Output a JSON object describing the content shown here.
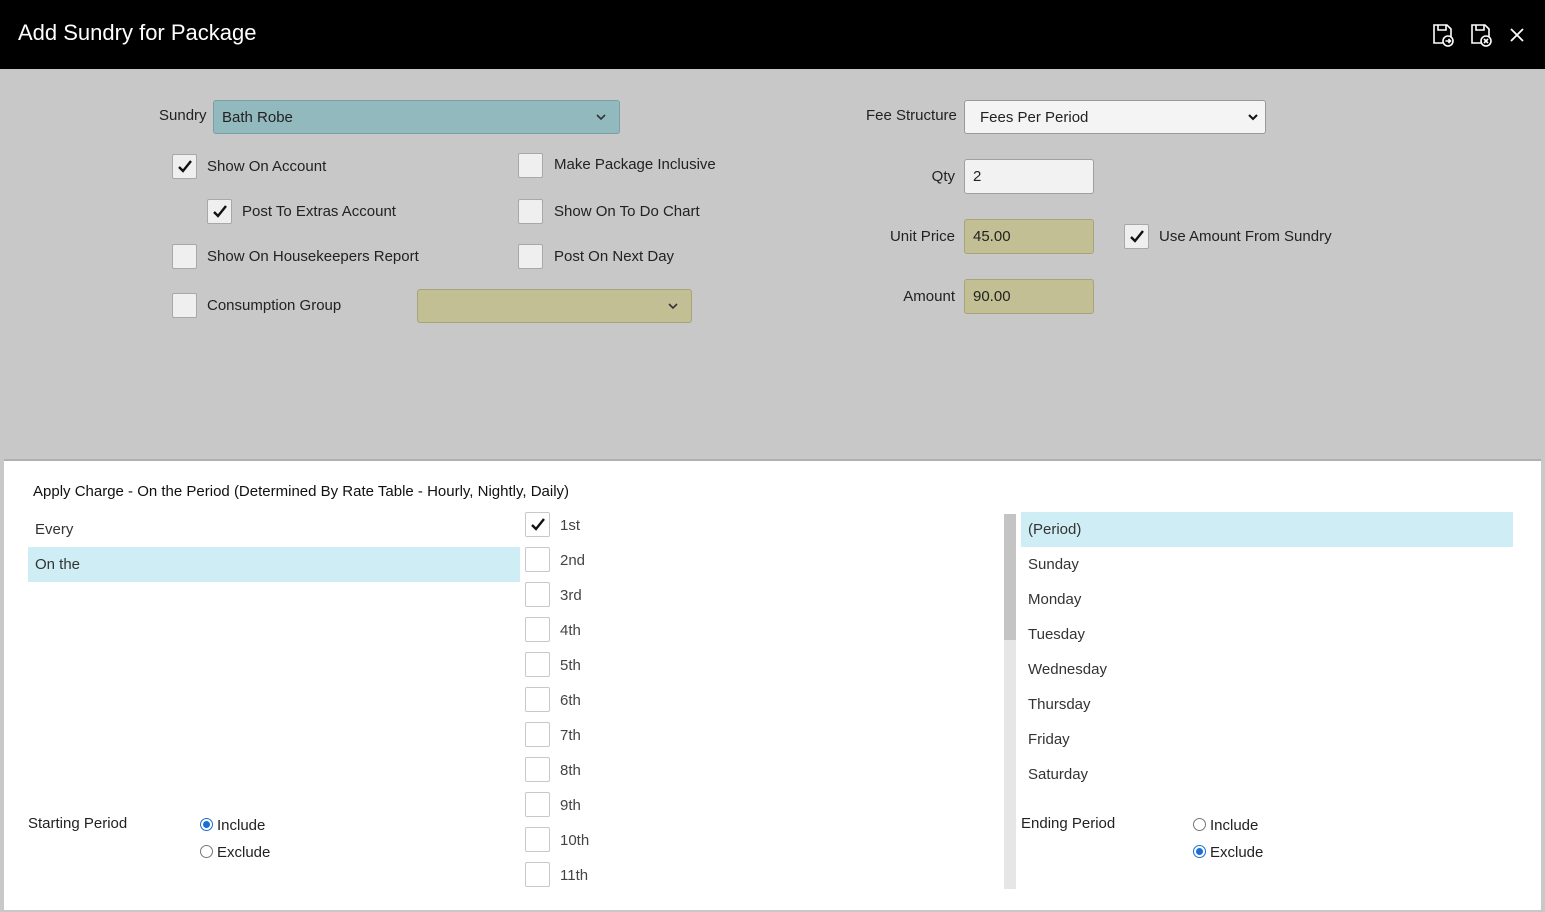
{
  "window": {
    "title": "Add Sundry for Package"
  },
  "toolbar": {
    "save_icon": "save-copy-icon",
    "save_close_icon": "save-close-icon",
    "close_icon": "close-icon"
  },
  "form": {
    "sundry_label": "Sundry",
    "sundry_value": "Bath Robe",
    "fee_structure_label": "Fee Structure",
    "fee_structure_value": "Fees Per Period",
    "qty_label": "Qty",
    "qty_value": "2",
    "unit_price_label": "Unit Price",
    "unit_price_value": "45.00",
    "amount_label": "Amount",
    "amount_value": "90.00",
    "use_amount_label": "Use Amount From Sundry",
    "show_on_account": "Show On Account",
    "post_to_extras": "Post To Extras Account",
    "show_on_housekeepers": "Show On Housekeepers Report",
    "consumption_group": "Consumption Group",
    "consumption_group_value": "",
    "make_package_inclusive": "Make Package Inclusive",
    "show_on_todo": "Show On To Do Chart",
    "post_on_next_day": "Post On Next Day"
  },
  "apply": {
    "title": "Apply Charge - On the Period (Determined By Rate Table - Hourly, Nightly, Daily)",
    "modes": [
      "Every",
      "On the"
    ],
    "selected_mode": "On the",
    "ordinals": [
      "1st",
      "2nd",
      "3rd",
      "4th",
      "5th",
      "6th",
      "7th",
      "8th",
      "9th",
      "10th",
      "11th"
    ],
    "checked_ordinal": "1st",
    "days": [
      "(Period)",
      "Sunday",
      "Monday",
      "Tuesday",
      "Wednesday",
      "Thursday",
      "Friday",
      "Saturday"
    ],
    "selected_day": "(Period)",
    "starting_period_label": "Starting Period",
    "ending_period_label": "Ending Period",
    "include_label": "Include",
    "exclude_label": "Exclude",
    "starting_period_value": "Include",
    "ending_period_value": "Exclude"
  }
}
